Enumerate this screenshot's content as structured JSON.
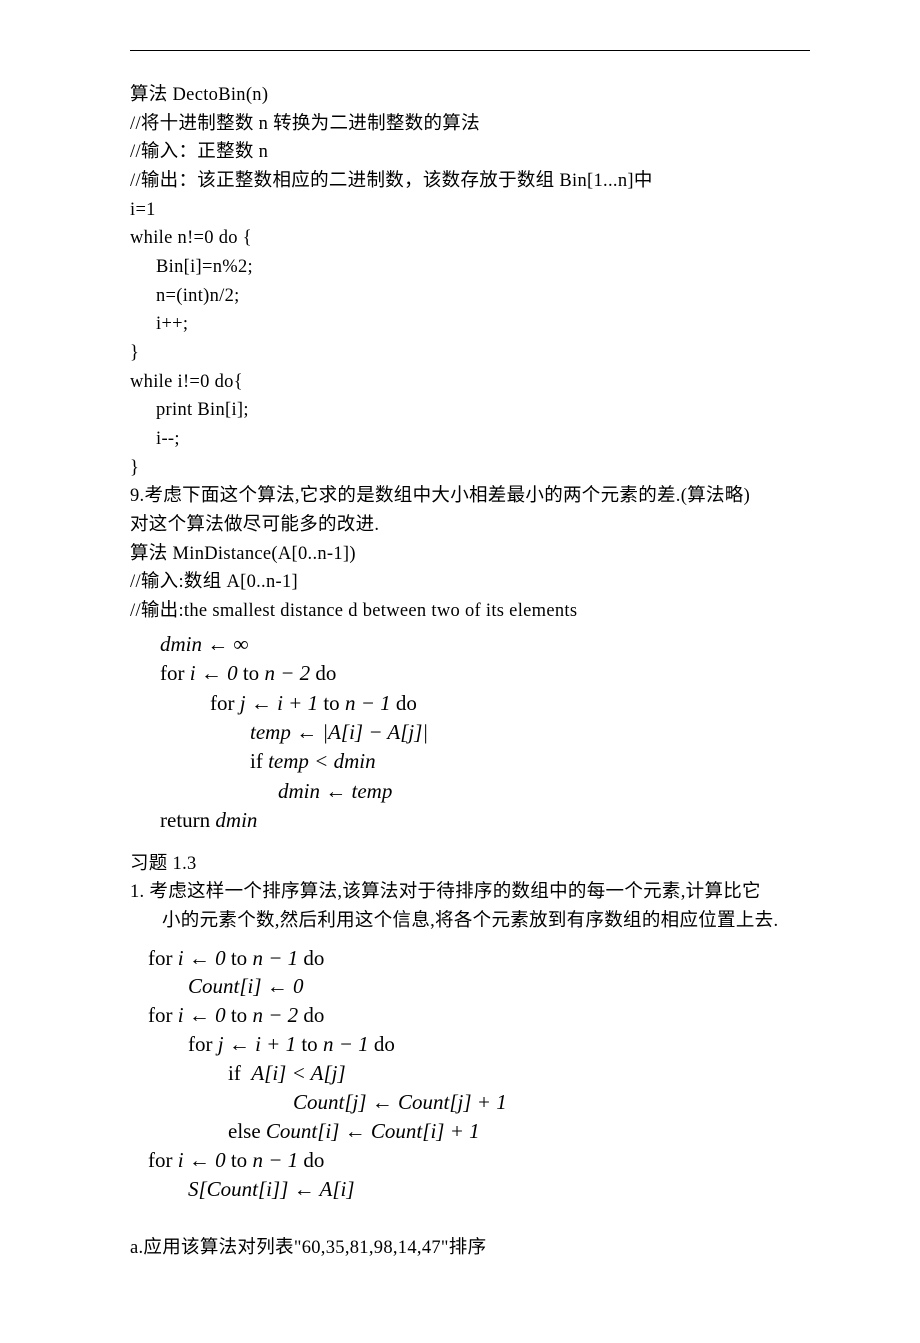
{
  "algo1": {
    "title": "算法 DectoBin(n)",
    "comment1": "//将十进制整数 n 转换为二进制整数的算法",
    "comment2": "//输入：正整数 n",
    "comment3": "//输出：该正整数相应的二进制数，该数存放于数组 Bin[1...n]中",
    "line_init": "i=1",
    "line_while1": "while n!=0 do {",
    "line_bin": "Bin[i]=n%2;",
    "line_n": "n=(int)n/2;",
    "line_ipp": "i++;",
    "line_close1": "}",
    "line_while2": "while i!=0 do{",
    "line_print": "print Bin[i];",
    "line_imm": "i--;",
    "line_close2": "}"
  },
  "q9": {
    "text1": "9.考虑下面这个算法,它求的是数组中大小相差最小的两个元素的差.(算法略)",
    "text2": "对这个算法做尽可能多的改进.",
    "text3": "算法 MinDistance(A[0..n-1])",
    "text4": "//输入:数组 A[0..n-1]",
    "text5": "//输出:the smallest distance d between two of its elements"
  },
  "pseudo1": {
    "l1": "dmin ← ∞",
    "l2_a": "for ",
    "l2_b": "i ← 0 ",
    "l2_c": "to ",
    "l2_d": "n − 2 ",
    "l2_e": "do",
    "l3_a": "for ",
    "l3_b": "j ← i + 1 ",
    "l3_c": "to ",
    "l3_d": "n − 1 ",
    "l3_e": "do",
    "l4": "temp ← |A[i] − A[j]|",
    "l5_a": "if ",
    "l5_b": "temp < dmin",
    "l6": "dmin ← temp",
    "l7_a": "return ",
    "l7_b": "dmin"
  },
  "ex13": {
    "header": "习题 1.3",
    "q1a": "1.  考虑这样一个排序算法,该算法对于待排序的数组中的每一个元素,计算比它",
    "q1b": "小的元素个数,然后利用这个信息,将各个元素放到有序数组的相应位置上去."
  },
  "pseudo2": {
    "l1_a": "for ",
    "l1_b": "i ← 0 ",
    "l1_c": "to ",
    "l1_d": "n − 1 ",
    "l1_e": "do",
    "l2": "Count[i] ← 0",
    "l3_a": "for ",
    "l3_b": "i ← 0 ",
    "l3_c": "to ",
    "l3_d": "n − 2 ",
    "l3_e": "do",
    "l4_a": "for ",
    "l4_b": "j ← i + 1 ",
    "l4_c": "to ",
    "l4_d": "n − 1 ",
    "l4_e": "do",
    "l5_a": "if  ",
    "l5_b": "A[i] < A[j]",
    "l6": "Count[j] ← Count[j] + 1",
    "l7_a": "else ",
    "l7_b": "Count[i] ← Count[i] + 1",
    "l8_a": "for ",
    "l8_b": "i ← 0 ",
    "l8_c": "to ",
    "l8_d": "n − 1 ",
    "l8_e": "do",
    "l9": "S[Count[i]] ← A[i]"
  },
  "qa": "a.应用该算法对列表\"60,35,81,98,14,47\"排序"
}
